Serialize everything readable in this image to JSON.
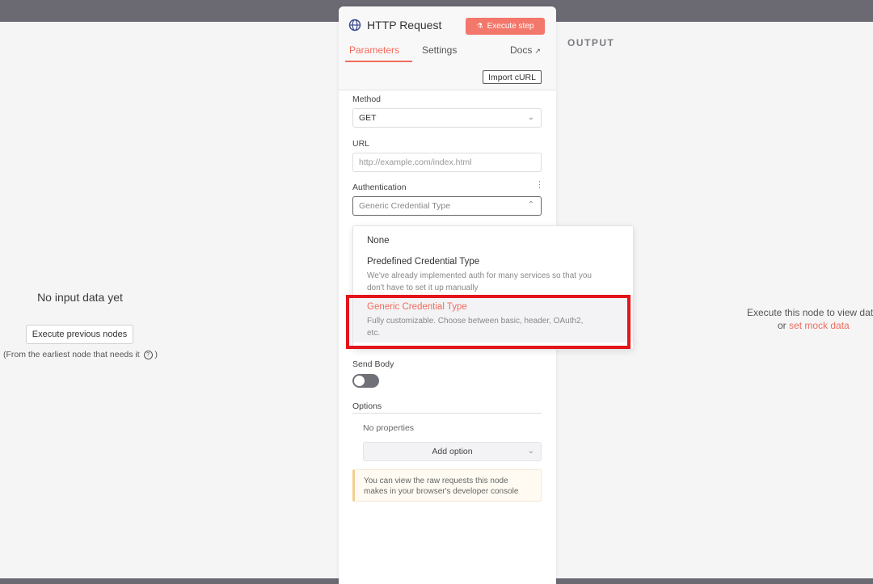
{
  "input_pane": {
    "title": "No input data yet",
    "exec_prev_label": "Execute previous nodes",
    "note": "(From the earliest node that needs it",
    "note_close": ")"
  },
  "output_pane": {
    "label": "OUTPUT",
    "msg": "Execute this node to view data",
    "msg_prefix": "or",
    "mock_link": "set mock data"
  },
  "panel": {
    "title": "HTTP Request",
    "execute_step_label": "Execute step",
    "tabs": {
      "parameters": "Parameters",
      "settings": "Settings",
      "docs": "Docs"
    },
    "import_curl": "Import cURL",
    "method": {
      "label": "Method",
      "value": "GET"
    },
    "url": {
      "label": "URL",
      "placeholder": "http://example.com/index.html"
    },
    "auth": {
      "label": "Authentication",
      "placeholder": "Generic Credential Type"
    },
    "send_body": {
      "label": "Send Body",
      "enabled": false
    },
    "options": {
      "label": "Options",
      "empty": "No properties",
      "add_label": "Add option"
    },
    "notice": [
      "You can view the raw requests this node",
      "makes in your browser's developer console"
    ]
  },
  "auth_dropdown": {
    "options": [
      {
        "title": "None",
        "desc": ""
      },
      {
        "title": "Predefined Credential Type",
        "desc1": "We've already implemented auth for many services so that you",
        "desc2": "don't have to set it up manually"
      },
      {
        "title": "Generic Credential Type",
        "desc1": "Fully customizable. Choose between basic, header, OAuth2,",
        "desc2": "etc."
      }
    ],
    "selected_index": 2
  },
  "colors": {
    "accent": "#f26b5b",
    "highlight_frame": "#e3141a",
    "topbar": "#6b6a73"
  },
  "icons": [
    "globe-icon",
    "flask-icon",
    "external-link-icon",
    "chevron-down-icon",
    "chevron-up-icon",
    "kebab-icon",
    "help-circle-icon"
  ]
}
